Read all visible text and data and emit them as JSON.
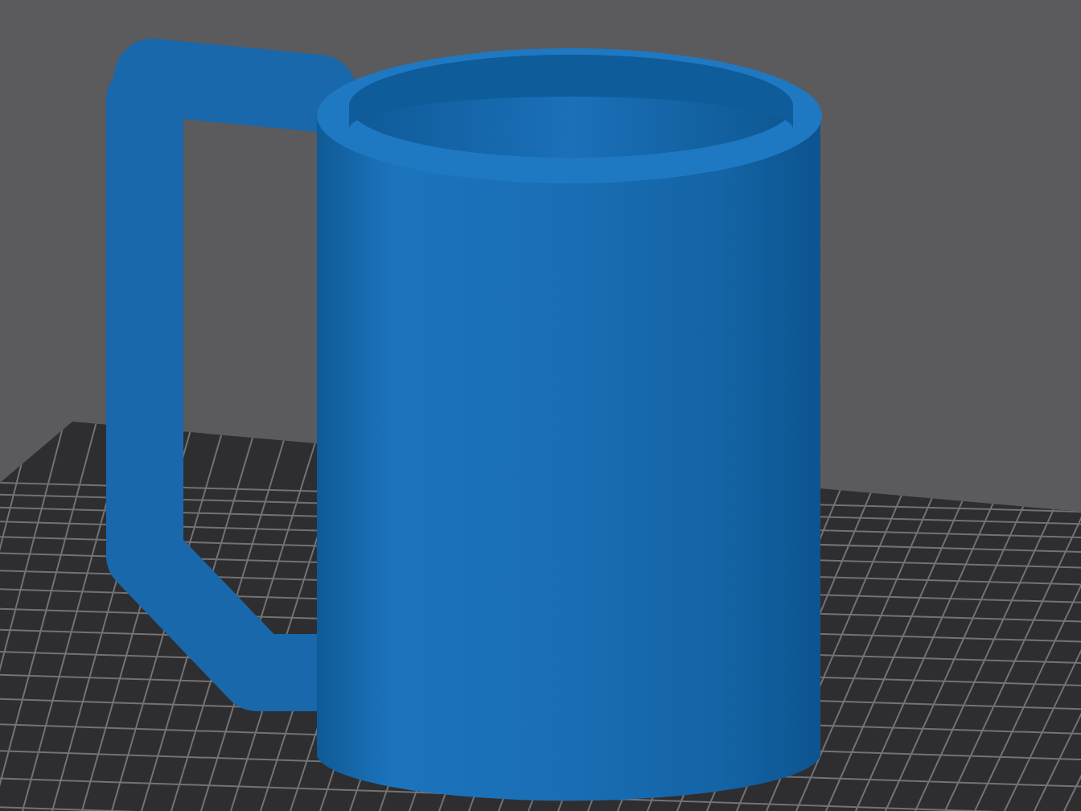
{
  "scene": {
    "kind": "mug"
  }
}
